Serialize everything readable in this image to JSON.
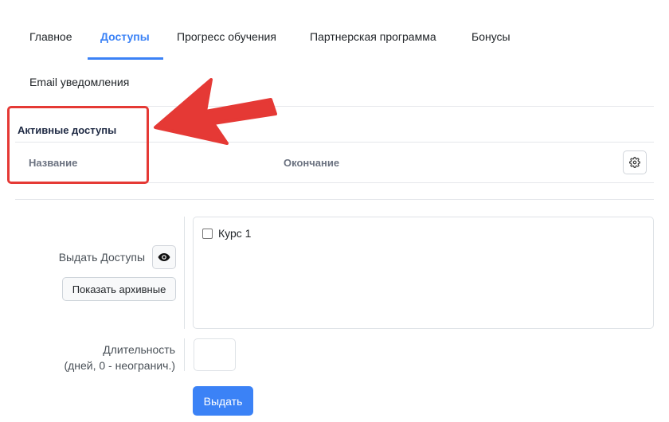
{
  "tabs": [
    {
      "label": "Главное",
      "active": false
    },
    {
      "label": "Доступы",
      "active": true
    },
    {
      "label": "Прогресс обучения",
      "active": false
    },
    {
      "label": "Партнерская программа",
      "active": false
    },
    {
      "label": "Бонусы",
      "active": false
    },
    {
      "label": "Email уведомления",
      "active": false
    }
  ],
  "active_access": {
    "title": "Активные доступы",
    "columns": [
      "Название",
      "Окончание"
    ],
    "settings_icon": "gear-icon"
  },
  "grant_form": {
    "grant_label": "Выдать Доступы",
    "eye_icon": "eye-icon",
    "show_archived_label": "Показать архивные",
    "courses": [
      {
        "label": "Курс 1",
        "checked": false
      }
    ],
    "duration_label_line1": "Длительность",
    "duration_label_line2": "(дней, 0 - неогранич.)",
    "duration_value": "",
    "submit_label": "Выдать"
  },
  "annotation": {
    "arrow_color": "#e53935",
    "box_color": "#e53935"
  }
}
